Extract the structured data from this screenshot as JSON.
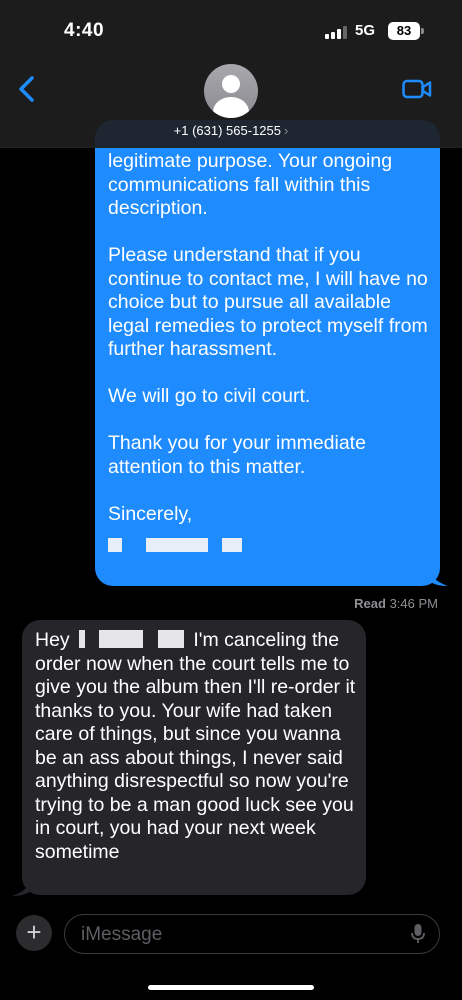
{
  "status": {
    "time": "4:40",
    "network": "5G",
    "battery": "83"
  },
  "contact": {
    "number": "+1 (631) 565-1255",
    "chevron": "›"
  },
  "sent_message": {
    "paragraphs": [
      "legitimate purpose. Your ongoing communications fall within this description.",
      "Please understand that if you continue to contact me, I will have no choice but to pursue all available legal remedies to protect myself from further harassment.",
      "We will go to civil court.",
      "Thank you for your immediate attention to this matter.",
      "Sincerely,"
    ]
  },
  "receipt": {
    "status": "Read",
    "time": "3:46 PM"
  },
  "received_message": {
    "greeting": "Hey",
    "body": "I'm canceling the order now when the court tells me to give you the album then I'll re-order it thanks to you. Your wife had taken care of things, but since you wanna be an ass about things, I never said anything disrespectful so now you're trying to be a man good luck see you in court, you had your next week sometime"
  },
  "composer": {
    "placeholder": "iMessage",
    "plus_label": "+"
  },
  "icons": {
    "back": "chevron-left-icon",
    "video": "video-camera-icon",
    "avatar": "person-icon",
    "mic": "microphone-icon",
    "plus": "plus-icon"
  },
  "colors": {
    "sent_bubble": "#1e8bff",
    "received_bubble": "#26252a",
    "accent": "#1e8bff"
  }
}
